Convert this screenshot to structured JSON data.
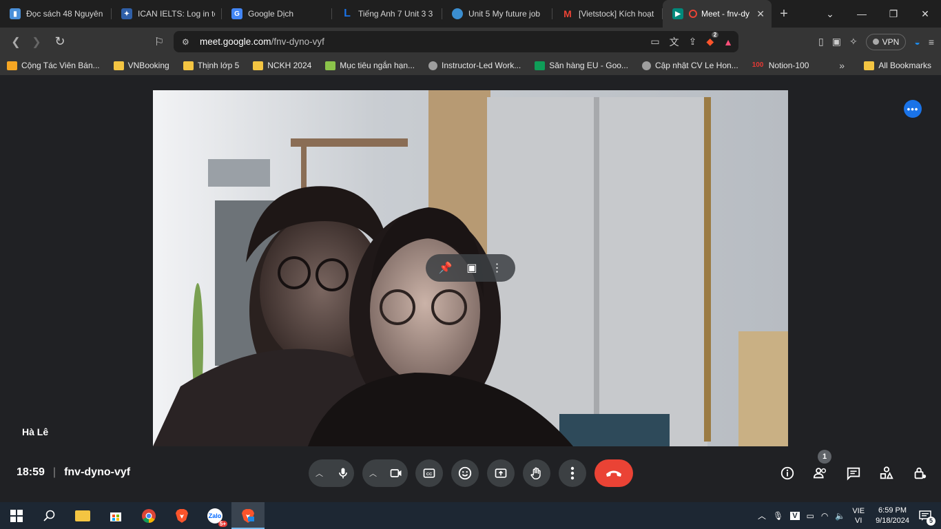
{
  "browser": {
    "tabs": [
      {
        "title": "Đọc sách 48 Nguyên",
        "favicon": "book-icon",
        "color": "#4a90d9"
      },
      {
        "title": "ICAN IELTS: Log in to",
        "favicon": "ican-icon",
        "color": "#2f5fa8"
      },
      {
        "title": "Google Dịch",
        "favicon": "translate-icon",
        "color": "#4285f4"
      },
      {
        "title": "Tiếng Anh 7 Unit 3 3",
        "favicon": "letter-l-icon",
        "color": "#1a73e8"
      },
      {
        "title": "Unit 5 My future job",
        "favicon": "globe-icon",
        "color": "#3b8ed0"
      },
      {
        "title": "[Vietstock] Kích hoạt",
        "favicon": "gmail-icon",
        "color": "#ea4335"
      },
      {
        "title": "Meet - fnv-dy",
        "favicon": "meet-icon",
        "color": "#00897b",
        "active": true
      }
    ],
    "new_tab": "+",
    "url_host": "meet.google.com",
    "url_path": "/fnv-dyno-vyf",
    "vpn_label": "VPN",
    "brave_badge": "2",
    "bookmarks": [
      {
        "label": "Cộng Tác Viên Bán...",
        "icon": "star-icon",
        "color": "#f5a623"
      },
      {
        "label": "VNBooking",
        "icon": "folder-icon"
      },
      {
        "label": "Thịnh lớp 5",
        "icon": "folder-icon"
      },
      {
        "label": "NCKH 2024",
        "icon": "folder-icon"
      },
      {
        "label": "Mục tiêu ngắn hạn...",
        "icon": "mountain-icon",
        "color": "#8bc34a"
      },
      {
        "label": "Instructor-Led Work...",
        "icon": "globe-icon",
        "color": "#9e9e9e"
      },
      {
        "label": "Săn hàng EU - Goo...",
        "icon": "sheets-icon",
        "color": "#0f9d58"
      },
      {
        "label": "Cập nhật CV Le Hon...",
        "icon": "globe-icon",
        "color": "#9e9e9e"
      },
      {
        "label": "Notion-100",
        "icon": "hundred-icon",
        "color": "#e53935"
      }
    ],
    "bookmarks_more": "»",
    "all_bookmarks": "All Bookmarks"
  },
  "meet": {
    "participant_name": "Hà Lê",
    "time": "18:59",
    "separator": "|",
    "meeting_code": "fnv-dyno-vyf",
    "people_count": "1"
  },
  "taskbar": {
    "lang_top": "VIE",
    "lang_bottom": "VI",
    "time": "6:59 PM",
    "date": "9/18/2024",
    "zalo_badge": "5+",
    "notifications": "5"
  },
  "colors": {
    "meet_bg": "#202124",
    "control_bg": "#3c4043",
    "end_call": "#ea4335",
    "accent": "#1a73e8"
  }
}
